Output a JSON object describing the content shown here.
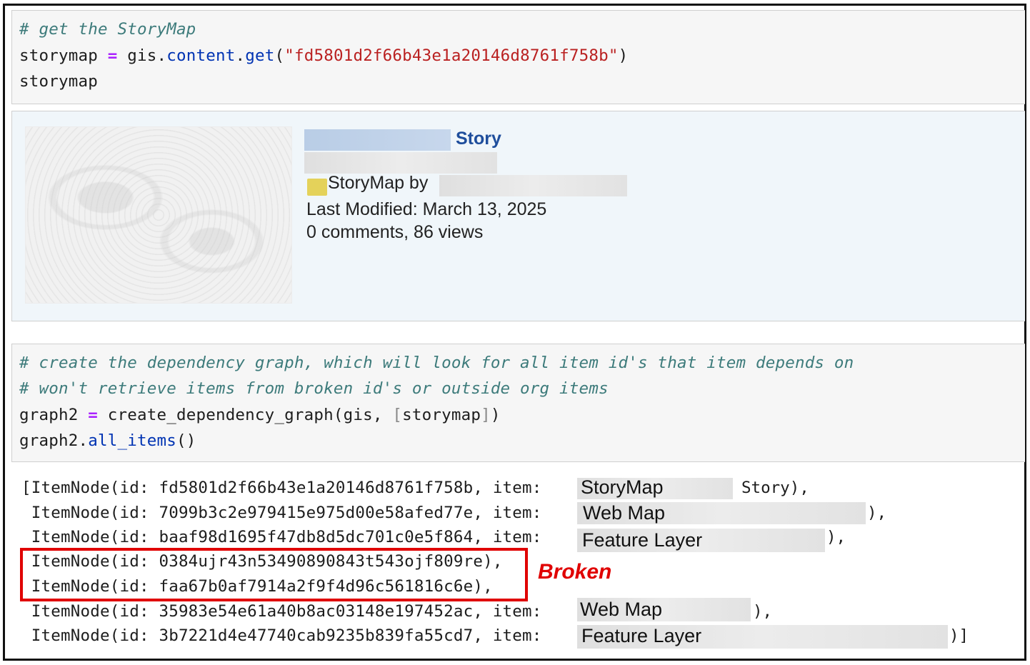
{
  "cell1": {
    "comment": "# get the StoryMap",
    "line2": {
      "var": "storymap",
      "op": "=",
      "obj": "gis.",
      "attr": "content",
      "dot": ".",
      "fn": "get",
      "open": "(",
      "str": "\"fd5801d2f66b43e1a20146d8761f758b\"",
      "close": ")"
    },
    "line3": "storymap"
  },
  "card": {
    "title": "Story",
    "type_line": "StoryMap by",
    "modified": "Last Modified: March 13, 2025",
    "stats": "0 comments, 86 views"
  },
  "cell2": {
    "comment1": "# create the dependency graph, which will look for all item id's that item depends on",
    "comment2": "# won't retrieve items from broken id's or outside org items",
    "line3": {
      "lhs": "graph2",
      "op": "=",
      "call": "create_dependency_graph(gis, ",
      "bo": "[",
      "arg": "storymap",
      "bc": "]",
      "end": ")"
    },
    "line4": {
      "obj": "graph2.",
      "fn": "all_items",
      "end": "()"
    }
  },
  "output": {
    "rows": [
      {
        "prefix": "[ItemNode(id: fd5801d2f66b43e1a20146d8761f758b, item: ",
        "label": "StoryMap",
        "tail": "Story),"
      },
      {
        "prefix": " ItemNode(id: 7099b3c2e979415e975d00e58afed77e, item: ",
        "label": "Web Map",
        "tail": "),"
      },
      {
        "prefix": " ItemNode(id: baaf98d1695f47db8d5dc701c0e5f864, item: ",
        "label": "Feature Layer",
        "tail": "),"
      },
      {
        "prefix": " ItemNode(id: 0384ujr43n53490890843t543ojf809re),",
        "label": "",
        "tail": ""
      },
      {
        "prefix": " ItemNode(id: faa67b0af7914a2f9f4d96c561816c6e),",
        "label": "",
        "tail": ""
      },
      {
        "prefix": " ItemNode(id: 35983e54e61a40b8ac03148e197452ac, item: ",
        "label": "Web Map",
        "tail": "),"
      },
      {
        "prefix": " ItemNode(id: 3b7221d4e47740cab9235b839fa55cd7, item: ",
        "label": "Feature Layer",
        "tail": ")]"
      }
    ],
    "annotation": "Broken",
    "annotation_color": "#e00000"
  }
}
